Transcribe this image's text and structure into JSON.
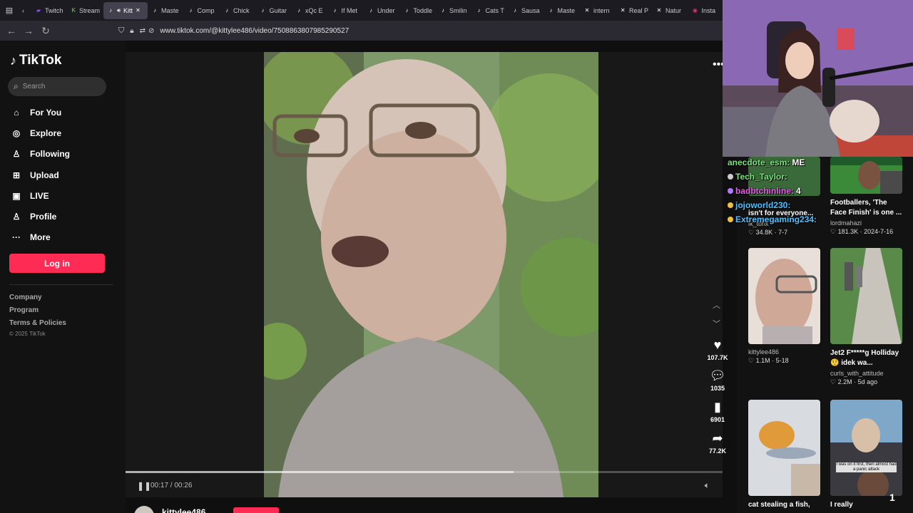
{
  "browser": {
    "tabs": [
      {
        "label": "Twitch",
        "icon": "twitch-icon",
        "active": false
      },
      {
        "label": "Stream",
        "icon": "stream-icon",
        "active": false
      },
      {
        "label": "Kitt",
        "icon": "tiktok-icon",
        "active": true
      },
      {
        "label": "Maste",
        "icon": "tiktok-icon",
        "active": false
      },
      {
        "label": "Comp",
        "icon": "tiktok-icon",
        "active": false
      },
      {
        "label": "Chick",
        "icon": "tiktok-icon",
        "active": false
      },
      {
        "label": "Guitar",
        "icon": "tiktok-icon",
        "active": false
      },
      {
        "label": "xQc E",
        "icon": "tiktok-icon",
        "active": false
      },
      {
        "label": "If Met",
        "icon": "tiktok-icon",
        "active": false
      },
      {
        "label": "Under",
        "icon": "tiktok-icon",
        "active": false
      },
      {
        "label": "Toddle",
        "icon": "tiktok-icon",
        "active": false
      },
      {
        "label": "Smilin",
        "icon": "tiktok-icon",
        "active": false
      },
      {
        "label": "Cats T",
        "icon": "tiktok-icon",
        "active": false
      },
      {
        "label": "Sausa",
        "icon": "tiktok-icon",
        "active": false
      },
      {
        "label": "Maste",
        "icon": "tiktok-icon",
        "active": false
      },
      {
        "label": "intern",
        "icon": "x-icon",
        "active": false
      },
      {
        "label": "Real P",
        "icon": "x-icon",
        "active": false
      },
      {
        "label": "Natur",
        "icon": "x-icon",
        "active": false
      },
      {
        "label": "Insta",
        "icon": "instagram-icon",
        "active": false
      }
    ],
    "url": "www.tiktok.com/@kittylee486/video/7508863807985290527"
  },
  "sidebar": {
    "logo": "TikTok",
    "search_placeholder": "Search",
    "nav": [
      {
        "label": "For You",
        "icon": "home-icon"
      },
      {
        "label": "Explore",
        "icon": "compass-icon"
      },
      {
        "label": "Following",
        "icon": "following-icon"
      },
      {
        "label": "Upload",
        "icon": "upload-icon"
      },
      {
        "label": "LIVE",
        "icon": "live-icon"
      },
      {
        "label": "Profile",
        "icon": "profile-icon"
      },
      {
        "label": "More",
        "icon": "more-icon"
      }
    ],
    "login_label": "Log in",
    "footer": [
      "Company",
      "Program",
      "Terms & Policies"
    ],
    "copyright": "© 2025 TikTok"
  },
  "player": {
    "current_time": "00:17",
    "duration": "00:26",
    "time_display": "00:17 / 00:26",
    "progress": 0.65,
    "likes": "107.7K",
    "comments": "1035",
    "saves": "6901",
    "shares": "77.2K",
    "author": "kittylee486"
  },
  "chat": [
    {
      "name": "anecdote_esm:",
      "msg": "ME",
      "color": "#7fe07f"
    },
    {
      "name": "Tech_Taylor:",
      "msg": "",
      "color": "#7fe07f"
    },
    {
      "name": "badbtchinline:",
      "msg": "4",
      "color": "#e060e0"
    },
    {
      "name": "jojoworld230:",
      "msg": "",
      "color": "#4fc0ff"
    },
    {
      "name": "Extremegaming234:",
      "msg": "",
      "color": "#4fc0ff"
    }
  ],
  "recommended": [
    {
      "title": "isn't for everyone...",
      "author": "ik_tbhx",
      "likes": "34.8K",
      "date": "7-7"
    },
    {
      "title": "Footballers, 'The Face Finish' is one ...",
      "author": "lordmahazi",
      "likes": "181.3K",
      "date": "2024-7-16"
    },
    {
      "title": "",
      "author": "kittylee486",
      "likes": "1.1M",
      "date": "5-18"
    },
    {
      "title": "Jet2 F*****g Holliday🤨 idek wa...",
      "author": "curls_with_attitude",
      "likes": "2.2M",
      "date": "5d ago"
    },
    {
      "title": "cat stealing a fish,",
      "author": "",
      "likes": "",
      "date": ""
    },
    {
      "title": "I really",
      "author": "",
      "likes": "",
      "date": ""
    }
  ],
  "overlay_caption": "I was on it first, then almost had a panic attack",
  "overlay_badge": "1"
}
